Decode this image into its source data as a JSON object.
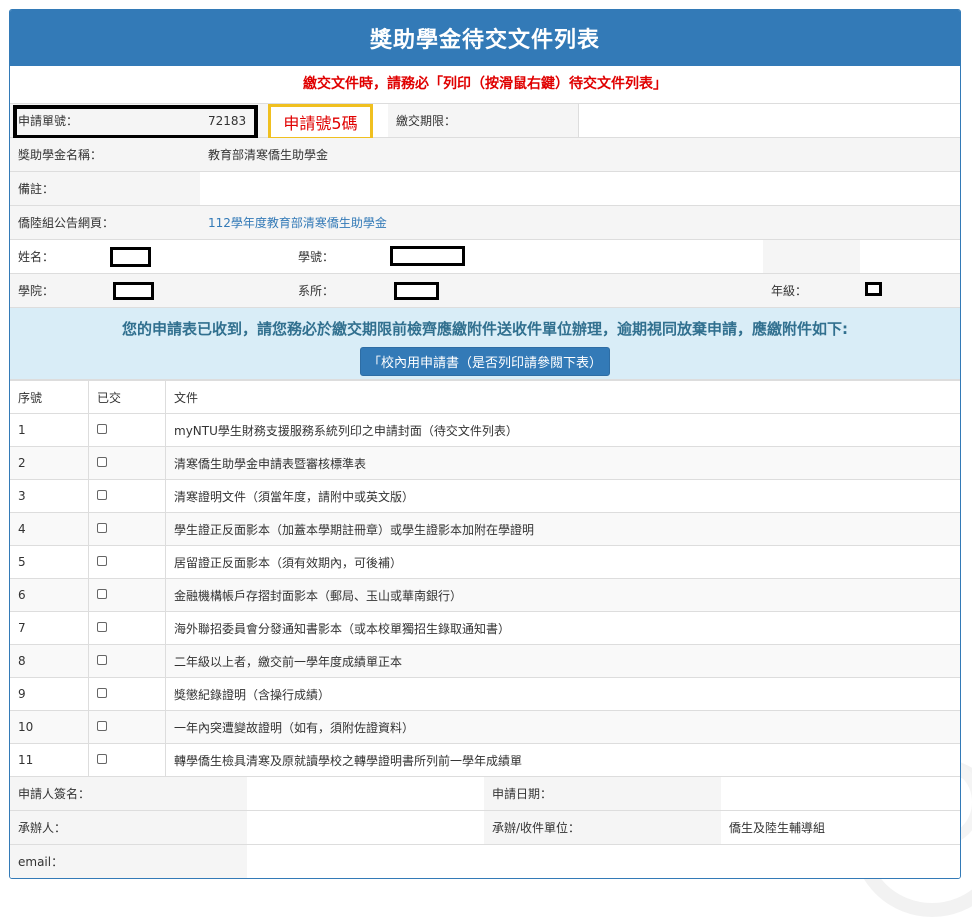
{
  "title": "獎助學金待交文件列表",
  "notice": "繳交文件時，請務必「列印（按滑鼠右鍵）待交文件列表」",
  "app": {
    "app_no_label": "申請單號：",
    "app_no": "72183",
    "app_no_annotation": "申請號5碼",
    "deadline_label": "繳交期限：",
    "deadline": "",
    "scholarship_label": "獎助學金名稱：",
    "scholarship": "教育部清寒僑生助學金",
    "remark_label": "備註：",
    "remark": "",
    "announce_label": "僑陸組公告網頁：",
    "announce_link": "112學年度教育部清寒僑生助學金"
  },
  "student": {
    "name_label": "姓名：",
    "id_label": "學號：",
    "college_label": "學院：",
    "dept_label": "系所：",
    "grade_label": "年級："
  },
  "info": {
    "message": "您的申請表已收到，請您務必於繳交期限前檢齊應繳附件送收件單位辦理，逾期視同放棄申請，應繳附件如下:",
    "button": "「校內用申請書（是否列印請參閱下表）"
  },
  "docs": {
    "headers": [
      "序號",
      "已交",
      "文件"
    ],
    "rows": [
      {
        "no": "1",
        "doc": "myNTU學生財務支援服務系統列印之申請封面（待交文件列表）"
      },
      {
        "no": "2",
        "doc": "清寒僑生助學金申請表暨審核標準表"
      },
      {
        "no": "3",
        "doc": "清寒證明文件（須當年度，請附中或英文版）"
      },
      {
        "no": "4",
        "doc": "學生證正反面影本（加蓋本學期註冊章）或學生證影本加附在學證明"
      },
      {
        "no": "5",
        "doc": "居留證正反面影本（須有效期內，可後補）"
      },
      {
        "no": "6",
        "doc": "金融機構帳戶存摺封面影本（郵局、玉山或華南銀行）"
      },
      {
        "no": "7",
        "doc": "海外聯招委員會分發通知書影本（或本校單獨招生錄取通知書）"
      },
      {
        "no": "8",
        "doc": "二年級以上者，繳交前一學年度成績單正本"
      },
      {
        "no": "9",
        "doc": "獎懲紀錄證明（含操行成績）"
      },
      {
        "no": "10",
        "doc": "一年內突遭變故證明（如有，須附佐證資料）"
      },
      {
        "no": "11",
        "doc": "轉學僑生檢具清寒及原就讀學校之轉學證明書所列前一學年成績單"
      }
    ]
  },
  "footer": {
    "signer_label": "申請人簽名：",
    "date_label": "申請日期：",
    "handler_label": "承辦人：",
    "unit_label": "承辦/收件單位：",
    "unit": "僑生及陸生輔導組",
    "email_label": "email："
  }
}
